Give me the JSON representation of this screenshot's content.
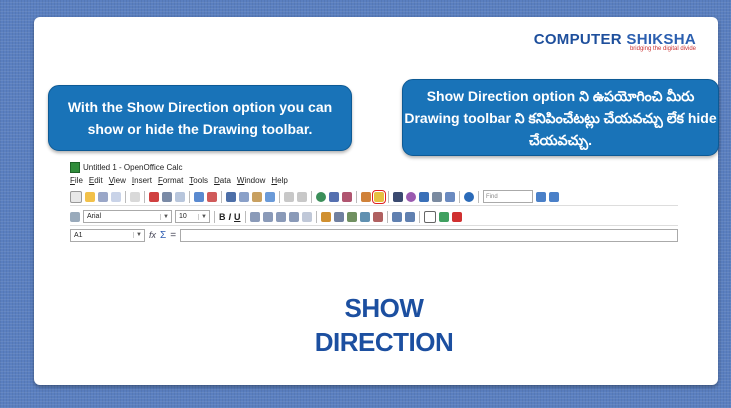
{
  "logo": {
    "name_a": "COMPUTER",
    "name_b": "SHIKSHA",
    "tagline": "bridging the digital divide"
  },
  "callouts": {
    "left": "With the Show Direction option you can show or hide the Drawing toolbar.",
    "right": "Show Direction option ని ఉపయోగించి మీరు Drawing toolbar ని కనిపించేటట్లు చేయవచ్చు లేక hide చేయవచ్చు."
  },
  "app": {
    "window_title": "Untitled 1 - OpenOffice Calc",
    "menu": [
      "File",
      "Edit",
      "View",
      "Insert",
      "Format",
      "Tools",
      "Data",
      "Window",
      "Help"
    ],
    "find_placeholder": "Find",
    "font_name": "Arial",
    "font_size": "10",
    "cell_ref": "A1",
    "bold": "B",
    "italic": "I",
    "underline": "U",
    "fx": "fx",
    "sum": "Σ",
    "equals": "="
  },
  "headline": {
    "line1": "SHOW",
    "line2": "DIRECTION"
  },
  "colors": {
    "callout_bg": "#1973b8",
    "headline": "#1c4fa0",
    "highlight": "#e02020",
    "background": "#5a7fc0"
  }
}
